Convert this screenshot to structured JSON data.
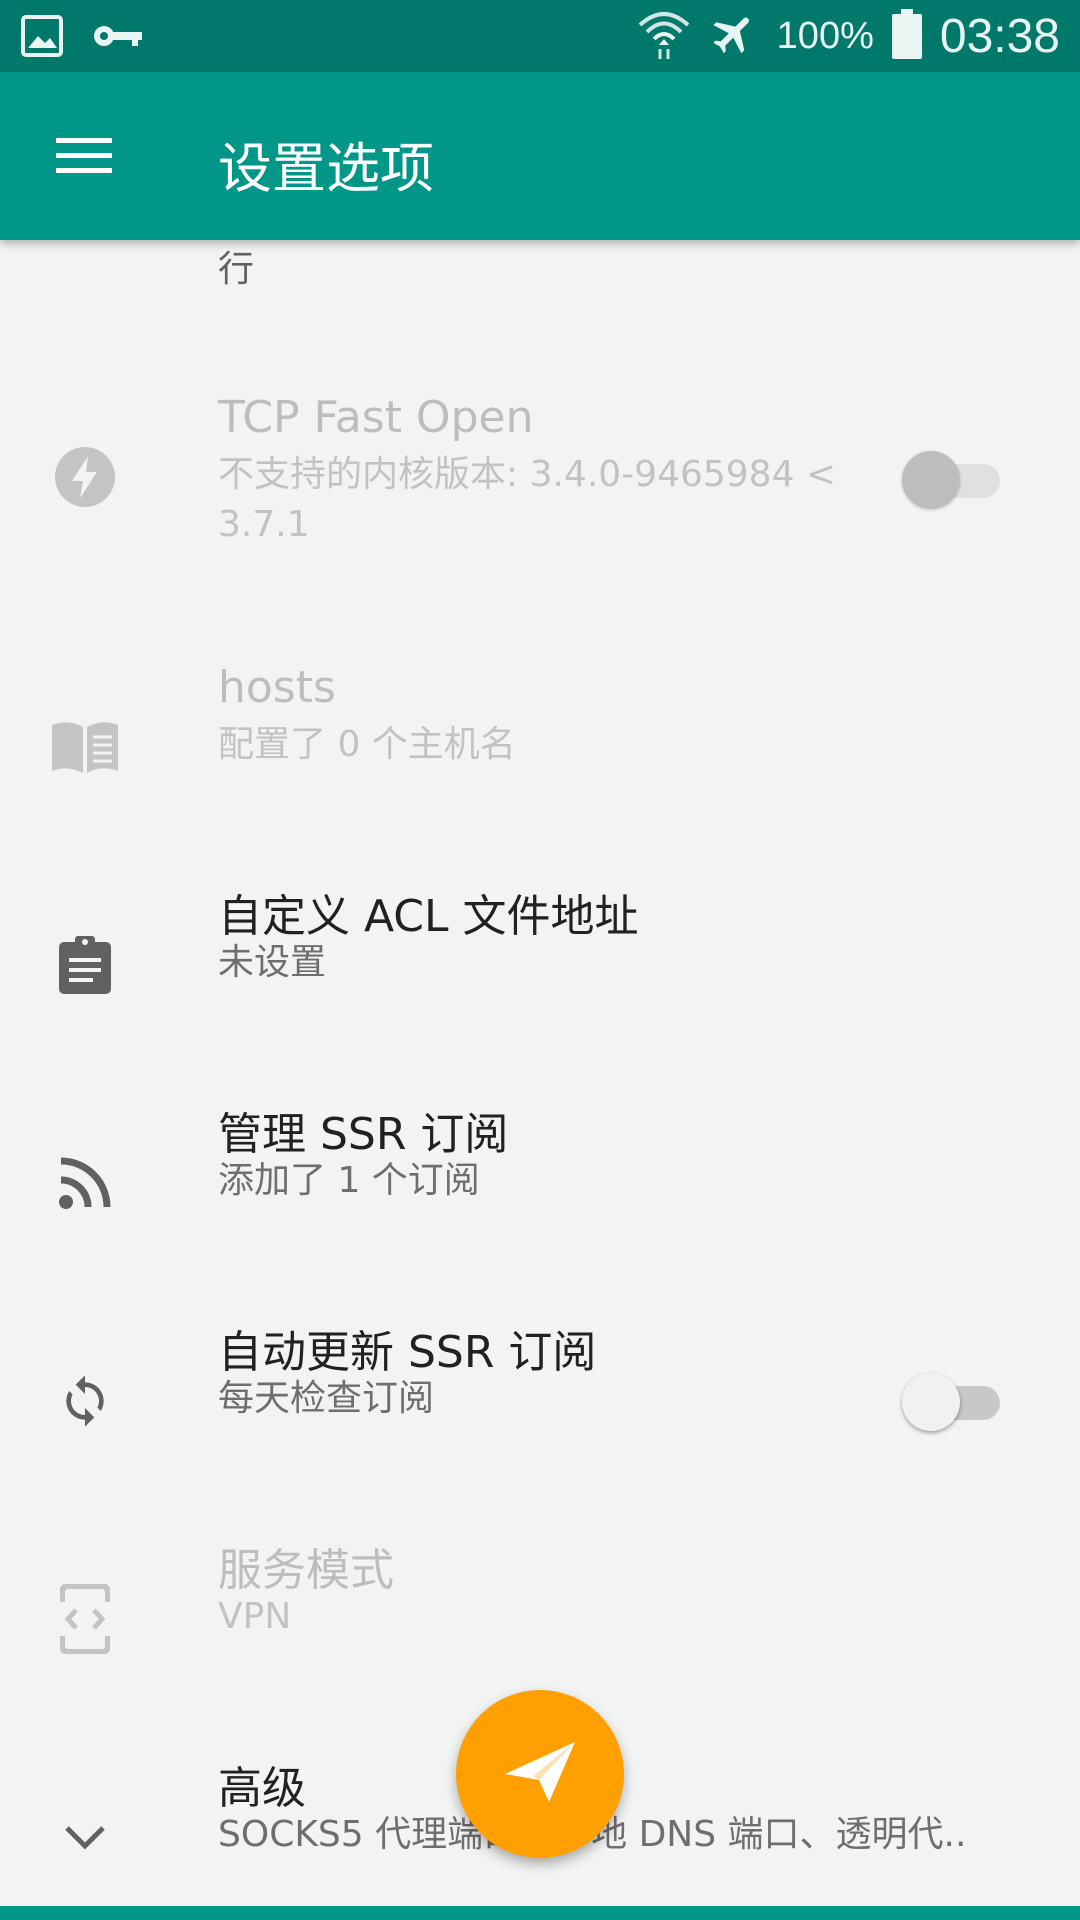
{
  "status_bar": {
    "battery": "100%",
    "time": "03:38",
    "icons": [
      "gallery-icon",
      "vpn-key-icon",
      "wifi-icon",
      "airplane-icon",
      "battery-icon"
    ]
  },
  "toolbar": {
    "title": "设置选项",
    "menu_icon": "menu-icon"
  },
  "content": {
    "partial_top_text": "行",
    "prefs": [
      {
        "title": "TCP Fast Open",
        "summary": "不支持的内核版本: 3.4.0-9465984 < 3.7.1",
        "icon": "flash-icon",
        "enabled": false,
        "switch": "off"
      },
      {
        "title": "hosts",
        "summary": "配置了 0 个主机名",
        "icon": "book-icon",
        "enabled": false
      },
      {
        "title": "自定义 ACL 文件地址",
        "summary": "未设置",
        "icon": "clipboard-icon",
        "enabled": true
      },
      {
        "title": "管理 SSR 订阅",
        "summary": "添加了 1 个订阅",
        "icon": "rss-icon",
        "enabled": true
      },
      {
        "title": "自动更新 SSR 订阅",
        "summary": "每天检查订阅",
        "icon": "sync-icon",
        "enabled": true,
        "switch": "off"
      },
      {
        "title": "服务模式",
        "summary": "VPN",
        "icon": "developer-mode-icon",
        "enabled": false
      },
      {
        "title": "高级",
        "summary": "SOCKS5 代理端口、本地 DNS 端口、透明代..",
        "icon": "chevron-down-icon",
        "enabled": true
      }
    ]
  },
  "fab": {
    "icon": "send-icon"
  },
  "colors": {
    "primary": "#009688",
    "primary_dark": "#00796b",
    "accent": "#ff9f00",
    "background": "#f2f4f4"
  }
}
